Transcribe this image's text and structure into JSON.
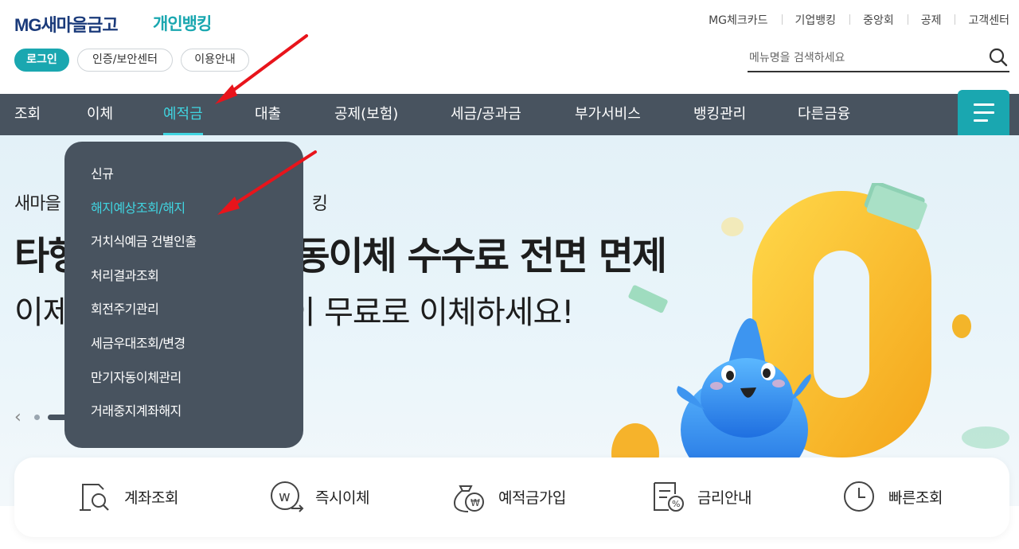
{
  "header": {
    "logo_main": "MG새마을금고",
    "logo_sub": "개인뱅킹",
    "login_label": "로그인",
    "cert_label": "인증/보안센터",
    "guide_label": "이용안내",
    "util_links": [
      "MG체크카드",
      "기업뱅킹",
      "중앙회",
      "공제",
      "고객센터"
    ],
    "search_placeholder": "메뉴명을 검색하세요"
  },
  "gnb": {
    "items": [
      "조회",
      "이체",
      "예적금",
      "대출",
      "공제(보험)",
      "세금/공과금",
      "부가서비스",
      "뱅킹관리",
      "다른금융"
    ],
    "active_index": 2
  },
  "dropdown": {
    "items": [
      "신규",
      "해지예상조회/해지",
      "거치식예금 건별인출",
      "처리결과조회",
      "회전주기관리",
      "세금우대조회/변경",
      "만기자동이체관리",
      "거래중지계좌해지"
    ],
    "highlight_index": 1
  },
  "banner": {
    "line1_left": "새마을",
    "line1_right": "킹",
    "line2_left": "타행",
    "line2_right": "동이체 수수료 전면 면제",
    "line3_left": "이제",
    "line3_right": "이 무료로 이체하세요!",
    "big_number": "0"
  },
  "quick": {
    "items": [
      "계좌조회",
      "즉시이체",
      "예적금가입",
      "금리안내",
      "빠른조회"
    ]
  },
  "colors": {
    "accent": "#1aa7b0",
    "active": "#40d4e0",
    "nav_bg": "#48535f",
    "arrow": "#e8141b"
  }
}
